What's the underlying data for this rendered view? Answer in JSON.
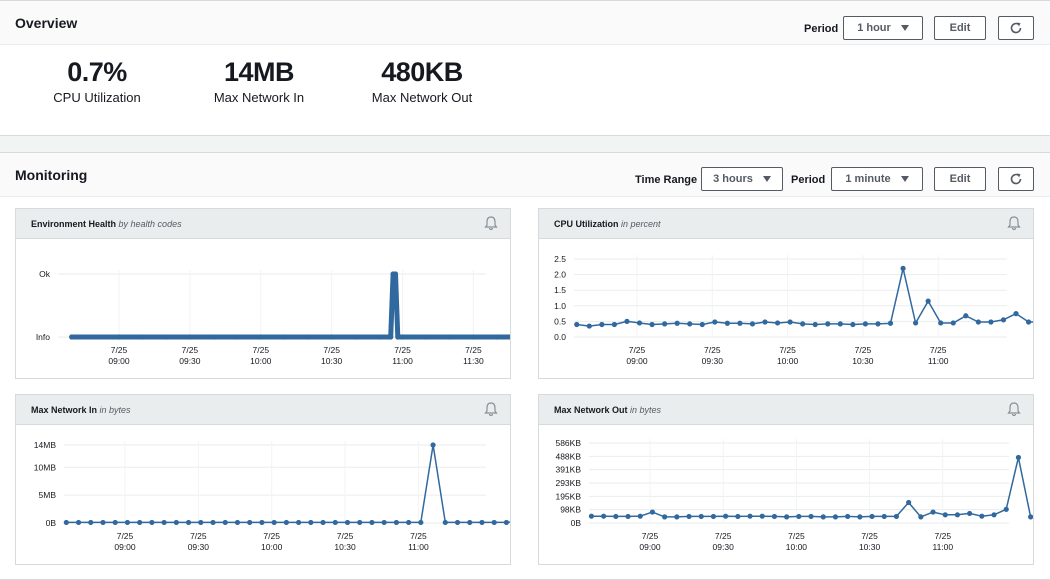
{
  "overview": {
    "title": "Overview",
    "period_label": "Period",
    "period_value": "1 hour",
    "edit_label": "Edit",
    "metrics": [
      {
        "value": "0.7%",
        "name": "CPU Utilization"
      },
      {
        "value": "14MB",
        "name": "Max Network In"
      },
      {
        "value": "480KB",
        "name": "Max Network Out"
      }
    ]
  },
  "monitoring": {
    "title": "Monitoring",
    "time_range_label": "Time Range",
    "time_range_value": "3 hours",
    "period_label": "Period",
    "period_value": "1 minute",
    "edit_label": "Edit"
  },
  "colors": {
    "series": "#31699e",
    "accent": "#545b64"
  },
  "chart_data": [
    {
      "type": "line",
      "title": "Environment Health",
      "subtitle": "by health codes",
      "y_ticks": [
        "Info",
        "Ok"
      ],
      "x_ticks": [
        "7/25 09:00",
        "7/25 09:30",
        "7/25 10:00",
        "7/25 10:30",
        "7/25 11:00",
        "7/25 11:30"
      ],
      "x": [
        -20,
        0,
        10,
        20,
        30,
        40,
        50,
        60,
        70,
        80,
        90,
        100,
        110,
        115,
        116,
        117,
        118,
        120,
        130,
        140,
        150,
        160,
        170,
        170.5
      ],
      "values": [
        0,
        0,
        0,
        0,
        0,
        0,
        0,
        0,
        0,
        0,
        0,
        0,
        0,
        0,
        1,
        1,
        0,
        0,
        0,
        0,
        0,
        0,
        0,
        0
      ],
      "x_unit": "minutes after 7/25 09:00",
      "ylim": [
        0,
        1
      ]
    },
    {
      "type": "line",
      "title": "CPU Utilization",
      "subtitle": "in percent",
      "y_ticks": [
        "2.5",
        "2.0",
        "1.5",
        "1.0",
        "0.5",
        "0.0"
      ],
      "x_ticks": [
        "7/25 09:00",
        "7/25 09:30",
        "7/25 10:00",
        "7/25 10:30",
        "7/25 11:00"
      ],
      "x": [
        -24,
        -19,
        -14,
        -9,
        -4,
        1,
        6,
        11,
        16,
        21,
        26,
        31,
        36,
        41,
        46,
        51,
        56,
        61,
        66,
        71,
        76,
        81,
        86,
        91,
        96,
        101,
        106,
        111,
        116,
        121,
        126,
        131,
        136,
        141,
        146,
        151,
        156,
        161,
        166,
        171
      ],
      "values": [
        0.4,
        0.35,
        0.4,
        0.4,
        0.5,
        0.45,
        0.4,
        0.42,
        0.44,
        0.42,
        0.4,
        0.48,
        0.44,
        0.44,
        0.42,
        0.48,
        0.45,
        0.48,
        0.42,
        0.4,
        0.42,
        0.42,
        0.4,
        0.42,
        0.42,
        0.44,
        2.2,
        0.45,
        1.15,
        0.45,
        0.45,
        0.68,
        0.48,
        0.48,
        0.55,
        0.75,
        0.48,
        0.48,
        0.48,
        0.48
      ],
      "x_unit": "minutes after 7/25 09:00",
      "ylim": [
        0,
        2.5
      ]
    },
    {
      "type": "line",
      "title": "Max Network In",
      "subtitle": "in bytes",
      "y_ticks": [
        "14MB",
        "10MB",
        "5MB",
        "0B"
      ],
      "x_ticks": [
        "7/25 09:00",
        "7/25 09:30",
        "7/25 10:00",
        "7/25 10:30",
        "7/25 11:00"
      ],
      "x": [
        -24,
        -19,
        -14,
        -9,
        -4,
        1,
        6,
        11,
        16,
        21,
        26,
        31,
        36,
        41,
        46,
        51,
        56,
        61,
        66,
        71,
        76,
        81,
        86,
        91,
        96,
        101,
        106,
        111,
        116,
        121,
        126,
        131,
        136,
        141,
        146,
        151,
        156,
        161,
        166
      ],
      "values": [
        0.1,
        0.1,
        0.1,
        0.1,
        0.1,
        0.1,
        0.1,
        0.1,
        0.1,
        0.1,
        0.1,
        0.1,
        0.1,
        0.1,
        0.1,
        0.1,
        0.1,
        0.1,
        0.1,
        0.1,
        0.1,
        0.1,
        0.1,
        0.1,
        0.1,
        0.1,
        0.1,
        0.1,
        0.1,
        0.1,
        14,
        0.1,
        0.1,
        0.1,
        0.1,
        0.1,
        0.1,
        0.3,
        0.1
      ],
      "x_unit": "minutes after 7/25 09:00",
      "y_unit": "MB",
      "ylim": [
        0,
        14
      ]
    },
    {
      "type": "line",
      "title": "Max Network Out",
      "subtitle": "in bytes",
      "y_ticks": [
        "586KB",
        "488KB",
        "391KB",
        "293KB",
        "195KB",
        "98KB",
        "0B"
      ],
      "x_ticks": [
        "7/25 09:00",
        "7/25 09:30",
        "7/25 10:00",
        "7/25 10:30",
        "7/25 11:00"
      ],
      "x": [
        -24,
        -19,
        -14,
        -9,
        -4,
        1,
        6,
        11,
        16,
        21,
        26,
        31,
        36,
        41,
        46,
        51,
        56,
        61,
        66,
        71,
        76,
        81,
        86,
        91,
        96,
        101,
        106,
        111,
        116,
        121,
        126,
        131,
        136,
        141,
        146,
        151,
        156,
        161,
        166,
        171
      ],
      "values": [
        50,
        50,
        48,
        48,
        50,
        80,
        45,
        45,
        48,
        48,
        48,
        50,
        48,
        50,
        50,
        48,
        45,
        48,
        48,
        45,
        45,
        48,
        45,
        48,
        48,
        48,
        150,
        45,
        80,
        60,
        60,
        70,
        50,
        60,
        100,
        480,
        45
      ],
      "x_unit": "minutes after 7/25 09:00",
      "y_unit": "KB",
      "ylim": [
        0,
        586
      ]
    }
  ]
}
